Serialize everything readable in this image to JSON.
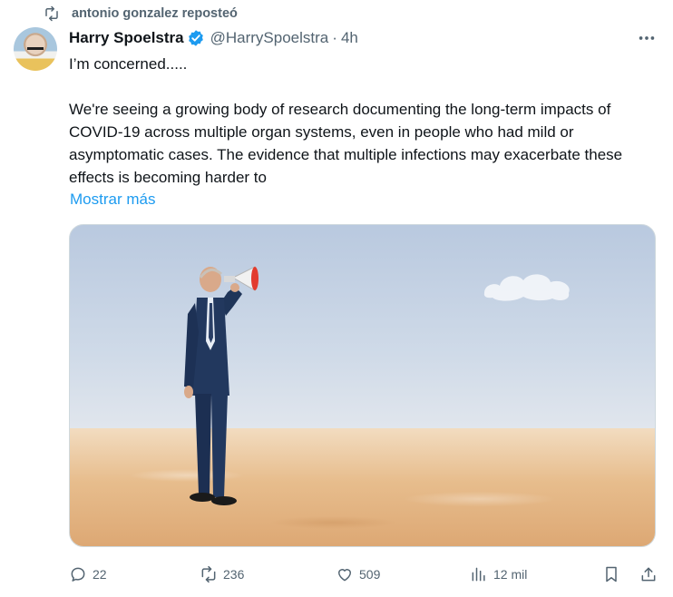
{
  "repost": {
    "icon": "repost-icon",
    "text": "antonio gonzalez reposteó"
  },
  "author": {
    "name": "Harry Spoelstra",
    "verified": true,
    "handle": "@HarrySpoelstra",
    "separator": "·",
    "time": "4h"
  },
  "tweet": {
    "line1": "I’m concerned.....",
    "body": "We're seeing a growing body of research documenting the long-term impacts of COVID-19 across multiple organ systems, even in people who had mild or asymptomatic cases. The evidence that multiple infections may exacerbate these effects is becoming harder to",
    "show_more": "Mostrar más"
  },
  "media": {
    "icon": "megaphone-man-photo"
  },
  "actions": {
    "replies": "22",
    "reposts": "236",
    "likes": "509",
    "views": "12 mil"
  },
  "colors": {
    "link": "#1d9bf0",
    "muted": "#536471",
    "text": "#0f1419",
    "verified": "#1d9bf0"
  }
}
